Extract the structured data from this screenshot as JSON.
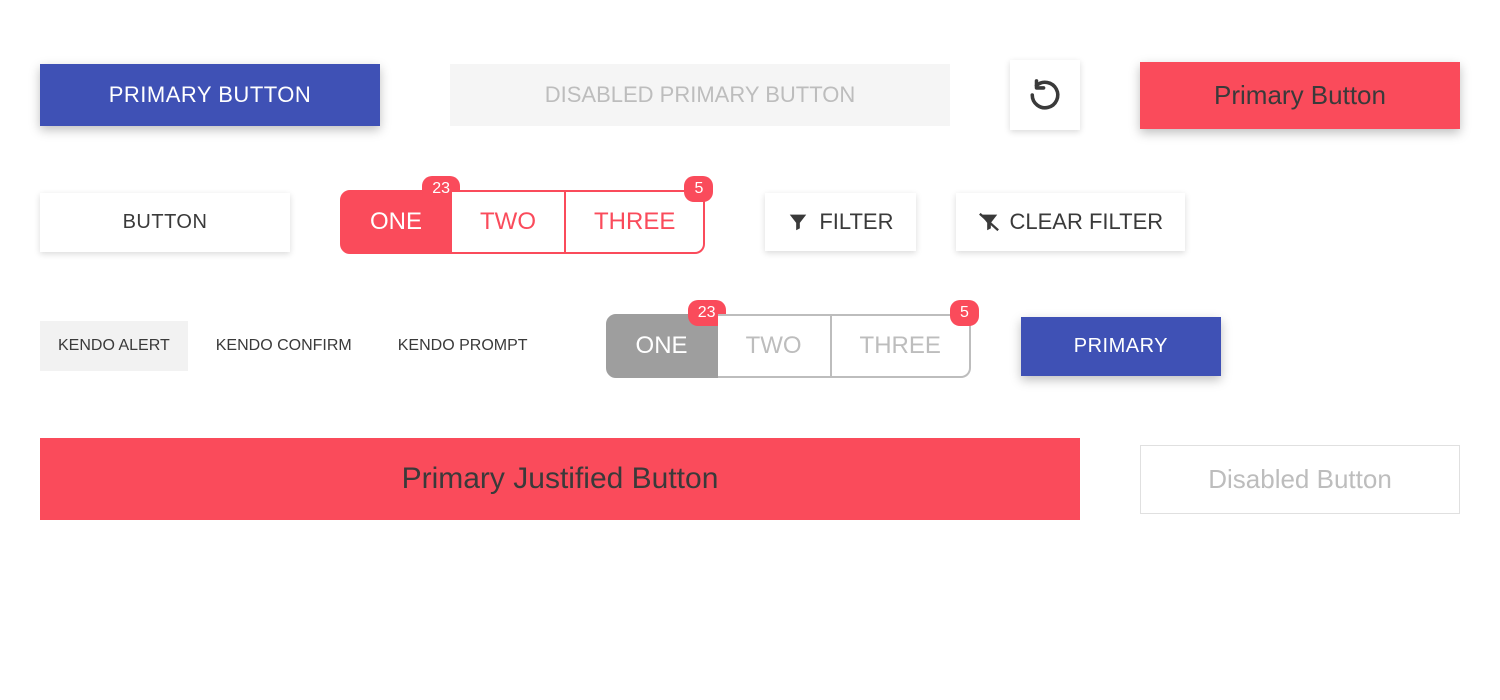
{
  "row1": {
    "primary_blue": "PRIMARY BUTTON",
    "disabled_primary": "DISABLED PRIMARY BUTTON",
    "primary_red": "Primary Button"
  },
  "row2": {
    "button_label": "BUTTON",
    "group": {
      "one": "ONE",
      "two": "TWO",
      "three": "THREE",
      "badge_one": "23",
      "badge_three": "5"
    },
    "filter": "FILTER",
    "clear_filter": "CLEAR FILTER"
  },
  "row3": {
    "alert": "KENDO ALERT",
    "confirm": "KENDO CONFIRM",
    "prompt": "KENDO PROMPT",
    "group": {
      "one": "ONE",
      "two": "TWO",
      "three": "THREE",
      "badge_one": "23",
      "badge_three": "5"
    },
    "primary": "PRIMARY"
  },
  "row4": {
    "justified": "Primary Justified Button",
    "disabled": "Disabled Button"
  }
}
